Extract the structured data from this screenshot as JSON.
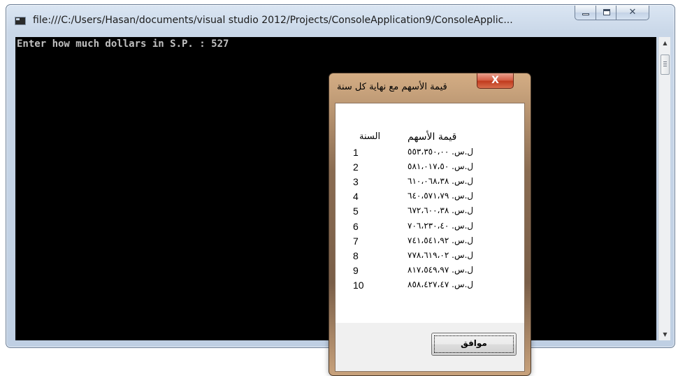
{
  "console": {
    "title": "file:///C:/Users/Hasan/documents/visual studio 2012/Projects/ConsoleApplication9/ConsoleApplic...",
    "minimize_icon": "minimize-icon",
    "maximize_icon": "maximize-icon",
    "close_glyph": "✕",
    "output": "Enter how much dollars in S.P. : 527",
    "scroll_up": "▲",
    "scroll_down": "▼"
  },
  "dialog": {
    "title": "قيمة الأسهم مع نهاية كل سنة",
    "close_glyph": "X",
    "header_year": "السنة",
    "header_value": "قيمة الأسهم",
    "rows": [
      {
        "year": "1",
        "value": "ل.س. ٥٥٣،٣٥٠،٠٠"
      },
      {
        "year": "2",
        "value": "ل.س. ٥٨١،٠١٧،٥٠"
      },
      {
        "year": "3",
        "value": "ل.س. ٦١٠،٠٦٨،٣٨"
      },
      {
        "year": "4",
        "value": "ل.س. ٦٤٠،٥٧١،٧٩"
      },
      {
        "year": "5",
        "value": "ل.س. ٦٧٢،٦٠٠،٣٨"
      },
      {
        "year": "6",
        "value": "ل.س. ٧٠٦،٢٣٠،٤٠"
      },
      {
        "year": "7",
        "value": "ل.س. ٧٤١،٥٤١،٩٢"
      },
      {
        "year": "8",
        "value": "ل.س. ٧٧٨،٦١٩،٠٢"
      },
      {
        "year": "9",
        "value": "ل.س. ٨١٧،٥٤٩،٩٧"
      },
      {
        "year": "10",
        "value": "ل.س. ٨٥٨،٤٢٧،٤٧"
      }
    ],
    "ok_label": "موافق"
  }
}
